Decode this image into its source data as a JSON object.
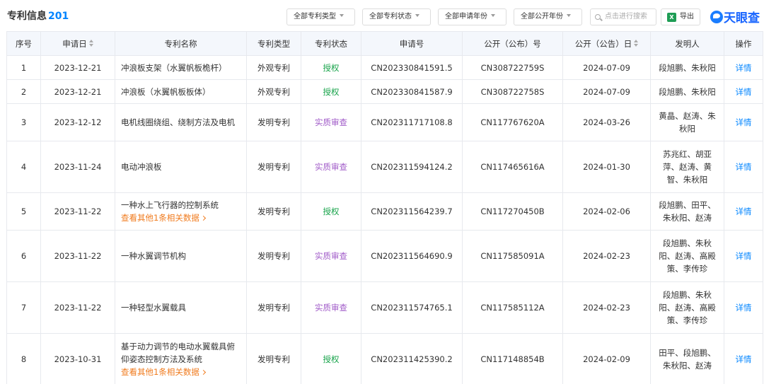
{
  "header": {
    "title": "专利信息",
    "count": "201",
    "filters": [
      "全部专利类型",
      "全部专利状态",
      "全部申请年份",
      "全部公开年份"
    ],
    "search_placeholder": "点击进行搜索",
    "export_label": "导出",
    "brand": "天眼查",
    "xls_icon_text": "X"
  },
  "table": {
    "columns": [
      "序号",
      "申请日",
      "专利名称",
      "专利类型",
      "专利状态",
      "申请号",
      "公开（公布）号",
      "公开（公告）日",
      "发明人",
      "操作"
    ],
    "rows": [
      {
        "no": "1",
        "app_date": "2023-12-21",
        "name": "冲浪板支架（水翼帆板桅杆）",
        "more": "",
        "type": "外观专利",
        "status": "授权",
        "status_kind": "grant",
        "app_no": "CN202330841591.5",
        "pub_no": "CN308722759S",
        "pub_date": "2024-07-09",
        "inventors": "段旭鹏、朱秋阳",
        "action": "详情"
      },
      {
        "no": "2",
        "app_date": "2023-12-21",
        "name": "冲浪板（水翼帆板板体）",
        "more": "",
        "type": "外观专利",
        "status": "授权",
        "status_kind": "grant",
        "app_no": "CN202330841587.9",
        "pub_no": "CN308722758S",
        "pub_date": "2024-07-09",
        "inventors": "段旭鹏、朱秋阳",
        "action": "详情"
      },
      {
        "no": "3",
        "app_date": "2023-12-12",
        "name": "电机线圈绕组、绕制方法及电机",
        "more": "",
        "type": "发明专利",
        "status": "实质审查",
        "status_kind": "exam",
        "app_no": "CN202311717108.8",
        "pub_no": "CN117767620A",
        "pub_date": "2024-03-26",
        "inventors": "黄晶、赵涛、朱秋阳",
        "action": "详情"
      },
      {
        "no": "4",
        "app_date": "2023-11-24",
        "name": "电动冲浪板",
        "more": "",
        "type": "发明专利",
        "status": "实质审查",
        "status_kind": "exam",
        "app_no": "CN202311594124.2",
        "pub_no": "CN117465616A",
        "pub_date": "2024-01-30",
        "inventors": "苏兆红、胡亚萍、赵涛、黄智、朱秋阳",
        "action": "详情"
      },
      {
        "no": "5",
        "app_date": "2023-11-22",
        "name": "一种水上飞行器的控制系统",
        "more": "查看其他1条相关数据",
        "type": "发明专利",
        "status": "授权",
        "status_kind": "grant",
        "app_no": "CN202311564239.7",
        "pub_no": "CN117270450B",
        "pub_date": "2024-02-06",
        "inventors": "段旭鹏、田平、朱秋阳、赵涛",
        "action": "详情"
      },
      {
        "no": "6",
        "app_date": "2023-11-22",
        "name": "一种水翼调节机构",
        "more": "",
        "type": "发明专利",
        "status": "实质审查",
        "status_kind": "exam",
        "app_no": "CN202311564690.9",
        "pub_no": "CN117585091A",
        "pub_date": "2024-02-23",
        "inventors": "段旭鹏、朱秋阳、赵涛、高殿策、李传珍",
        "action": "详情"
      },
      {
        "no": "7",
        "app_date": "2023-11-22",
        "name": "一种轻型水翼载具",
        "more": "",
        "type": "发明专利",
        "status": "实质审查",
        "status_kind": "exam",
        "app_no": "CN202311574765.1",
        "pub_no": "CN117585112A",
        "pub_date": "2024-02-23",
        "inventors": "段旭鹏、朱秋阳、赵涛、高殿策、李传珍",
        "action": "详情"
      },
      {
        "no": "8",
        "app_date": "2023-10-31",
        "name": "基于动力调节的电动水翼载具俯仰姿态控制方法及系统",
        "more": "查看其他1条相关数据",
        "type": "发明专利",
        "status": "授权",
        "status_kind": "grant",
        "app_no": "CN202311425390.2",
        "pub_no": "CN117148854B",
        "pub_date": "2024-02-09",
        "inventors": "田平、段旭鹏、朱秋阳、赵涛",
        "action": "详情"
      }
    ]
  }
}
